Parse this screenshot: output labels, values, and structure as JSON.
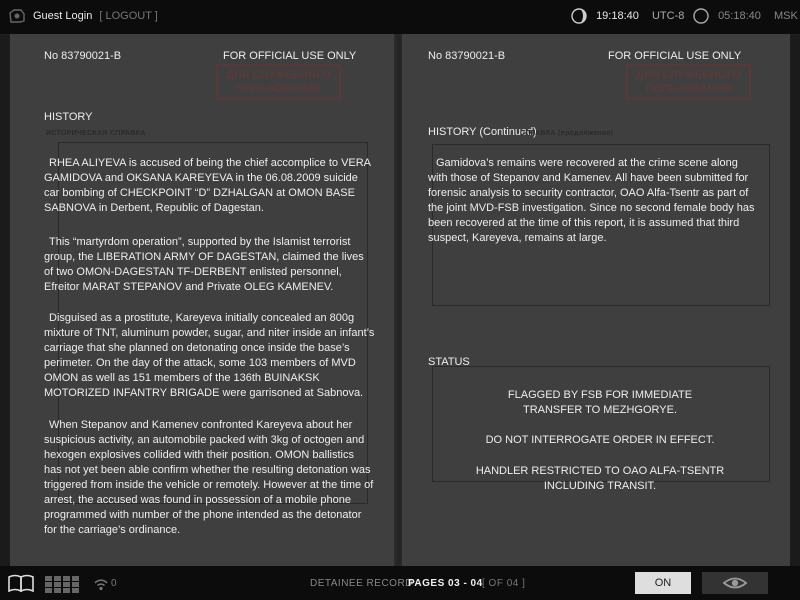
{
  "topbar": {
    "user": "Guest Login",
    "logout": "[ LOGOUT ]",
    "clock1_time": "19:18:40",
    "clock1_zone": "UTC-8",
    "clock2_time": "05:18:40",
    "clock2_zone": "MSK"
  },
  "left_page": {
    "doc_no": "No 83790021-B",
    "official": "FOR OFFICIAL USE ONLY",
    "stamp_line1": "ДЛЯ СЛУЖЕБНОГО",
    "stamp_line2": "ПОЛЬЗОВАНИЯ",
    "section": "HISTORY",
    "cyr_heading": "ИСТОРИЧЕСКАЯ СПРАВКА",
    "paragraphs": [
      "RHEA ALIYEVA is accused of being the chief accomplice to VERA GAMIDOVA and OKSANA KAREYEVA in the 06.08.2009 suicide car bombing of CHECKPOINT “D” DZHALGAN at OMON BASE SABNOVA in Derbent, Republic of Dagestan.",
      "This “martyrdom operation”, supported by the Islamist terrorist group, the LIBERATION ARMY OF DAGESTAN, claimed the lives of two OMON-DAGESTAN TF-DERBENT enlisted personnel, Efreitor MARAT STEPANOV and Private OLEG KAMENEV.",
      "Disguised as a prostitute, Kareyeva initially concealed an 800g mixture of TNT, aluminum powder, sugar, and niter inside an infant’s carriage that she planned on detonating once inside the base’s perimeter. On the day of the attack, some 103 members of MVD OMON as well as 151 members of the 136th BUINAKSK MOTORIZED INFANTRY BRIGADE were garrisoned at Sabnova.",
      "When Stepanov and Kamenev confronted Kareyeva about her suspicious activity, an automobile packed with 3kg of octogen and hexogen explosives collided with their position. OMON ballistics has not yet been able confirm whether the resulting detonation was triggered from inside the vehicle or remotely. However at the time of arrest, the accused was found in possession of a mobile phone programmed with number of the phone intended as the detonator for the carriage’s ordinance."
    ]
  },
  "right_page": {
    "doc_no": "No 83790021-B",
    "official": "FOR OFFICIAL USE ONLY",
    "stamp_line1": "ДЛЯ СЛУЖЕБНОГО",
    "stamp_line2": "ПОЛЬЗОВАНИЯ",
    "section": "HISTORY (Continued)",
    "cyr_heading": "СПРАВКА (продолжение)",
    "paragraph": "Gamidova’s remains were recovered at the crime scene along with those of Stepanov and Kamenev. All have been submitted for forensic analysis to security contractor, OAO Alfa-Tsentr as part of the joint MVD-FSB investigation. Since no second female body has been recovered at the time of this report, it is assumed that third suspect, Kareyeva, remains at large.",
    "status_section": "STATUS",
    "status_1a": "FLAGGED BY FSB FOR IMMEDIATE",
    "status_1b": "TRANSFER TO MEZHGORYE.",
    "status_2": "DO NOT INTERROGATE ORDER IN EFFECT.",
    "status_3a": "HANDLER RESTRICTED TO OAO ALFA-TSENTR",
    "status_3b": "INCLUDING TRANSIT."
  },
  "bottombar": {
    "wifi_count": "0",
    "record": "DETAINEE RECORD",
    "pages": "PAGES 03 - 04",
    "of": "[ OF 04 ]",
    "on": "ON"
  },
  "icons": [
    "camera-icon",
    "moon-icon",
    "clock-icon",
    "book-icon",
    "grid-icon",
    "wifi-icon",
    "eye-icon"
  ]
}
